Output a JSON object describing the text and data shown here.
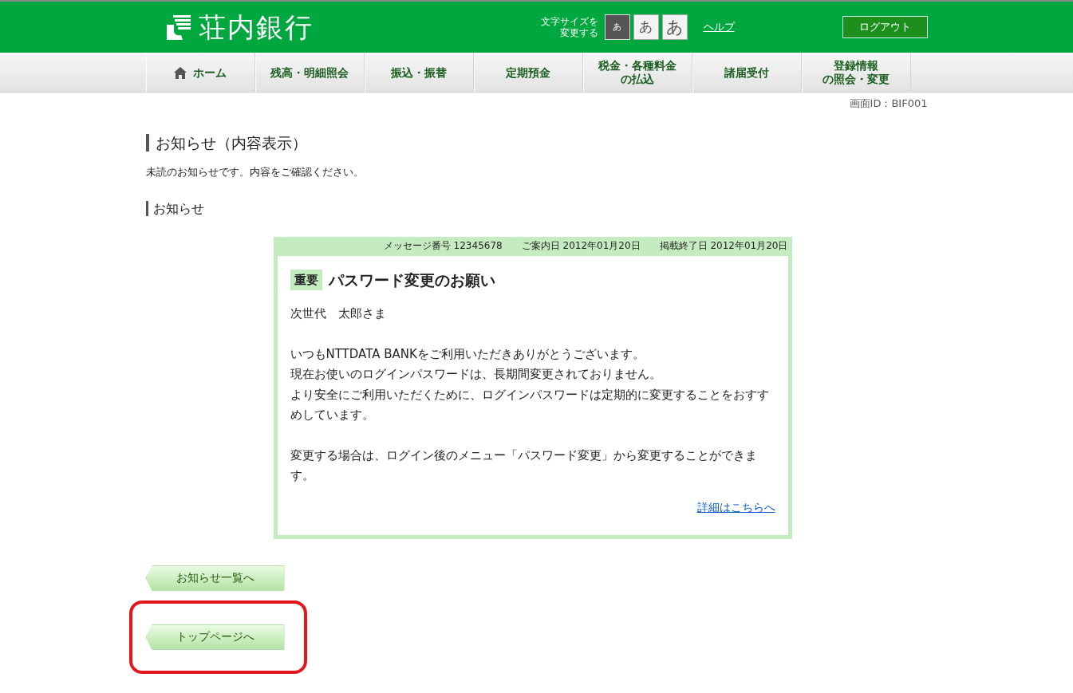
{
  "header": {
    "logo": "荘内銀行",
    "font_size_label": [
      "文字サイズを",
      "変更する"
    ],
    "font_sizes": [
      {
        "label": "あ",
        "selected": true
      },
      {
        "label": "あ",
        "selected": false
      },
      {
        "label": "あ",
        "selected": false
      }
    ],
    "help_link": "ヘルプ",
    "logout_button": "ログアウト"
  },
  "nav": [
    {
      "label": "ホーム",
      "kind": "home"
    },
    {
      "label": "残高・明細照会",
      "kind": "text"
    },
    {
      "label": "振込・振替",
      "kind": "text"
    },
    {
      "label": "定期預金",
      "kind": "text"
    },
    {
      "label": [
        "税金・各種料金",
        "の払込"
      ],
      "kind": "text"
    },
    {
      "label": "諸届受付",
      "kind": "text"
    },
    {
      "label": [
        "登録情報",
        "の照会・変更"
      ],
      "kind": "text"
    }
  ],
  "screen_id": "画面ID：BIF001",
  "page_title": "お知らせ（内容表示）",
  "intro": "未読のお知らせです。内容をご確認ください。",
  "section_title": "お知らせ",
  "notice": {
    "meta": [
      "メッセージ番号 12345678",
      "ご案内日 2012年01月20日",
      "掲載終了日 2012年01月20日"
    ],
    "tag": "重要",
    "title": "パスワード変更のお願い",
    "paragraphs": [
      [
        "次世代　太郎さま"
      ],
      [
        "いつもNTTDATA BANKをご利用いただきありがとうございます。",
        "現在お使いのログインパスワードは、長期間変更されておりません。",
        "より安全にご利用いただくために、ログインパスワードは定期的に変更することをおすすめしています。"
      ],
      [
        "変更する場合は、ログイン後のメニュー「パスワード変更」から変更することができます。"
      ]
    ],
    "detail_link": "詳細はこちらへ"
  },
  "buttons": [
    {
      "label": "お知らせ一覧へ",
      "highlighted": false
    },
    {
      "label": "トップページへ",
      "highlighted": true
    }
  ]
}
